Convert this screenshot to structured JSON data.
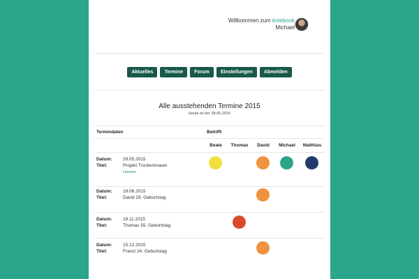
{
  "header": {
    "welcome_prefix": "Willkommen zum",
    "brand": "kniebook",
    "user": "Michael"
  },
  "nav": [
    "Aktuelles",
    "Termine",
    "Forum",
    "Einstellungen",
    "Abmelden"
  ],
  "main": {
    "title": "Alle ausstehenden Termine 2015",
    "subtitle": "Heute ist der 28.05.2015"
  },
  "table": {
    "col_dates": "Termindaten",
    "col_concerns": "Betrifft",
    "people": [
      "Beate",
      "Thomas",
      "David",
      "Michael",
      "Matthias"
    ],
    "date_label": "Datum:",
    "title_label": "Titel:",
    "delete_label": "Löschen",
    "rows": [
      {
        "date": "29.05.2015",
        "title": "Projekt Trockenmauer",
        "deletable": true,
        "people": [
          "Beate",
          "David",
          "Michael",
          "Matthias"
        ]
      },
      {
        "date": "18.06.2015",
        "title": "David 29. Geburtstag",
        "deletable": false,
        "people": [
          "David"
        ]
      },
      {
        "date": "19.11.2015",
        "title": "Thomas 55. Geburtstag",
        "deletable": false,
        "people": [
          "Thomas"
        ]
      },
      {
        "date": "15.12.2015",
        "title": "Franzi 24. Geburtstag",
        "deletable": false,
        "people": [
          "David"
        ]
      }
    ]
  },
  "colors": {
    "background": "#2ba68c",
    "nav_button": "#17594b",
    "Beate": "#f2df3e",
    "Thomas": "#d94a2b",
    "David": "#f0923e",
    "Michael": "#2aa58a",
    "Matthias": "#23396b"
  }
}
